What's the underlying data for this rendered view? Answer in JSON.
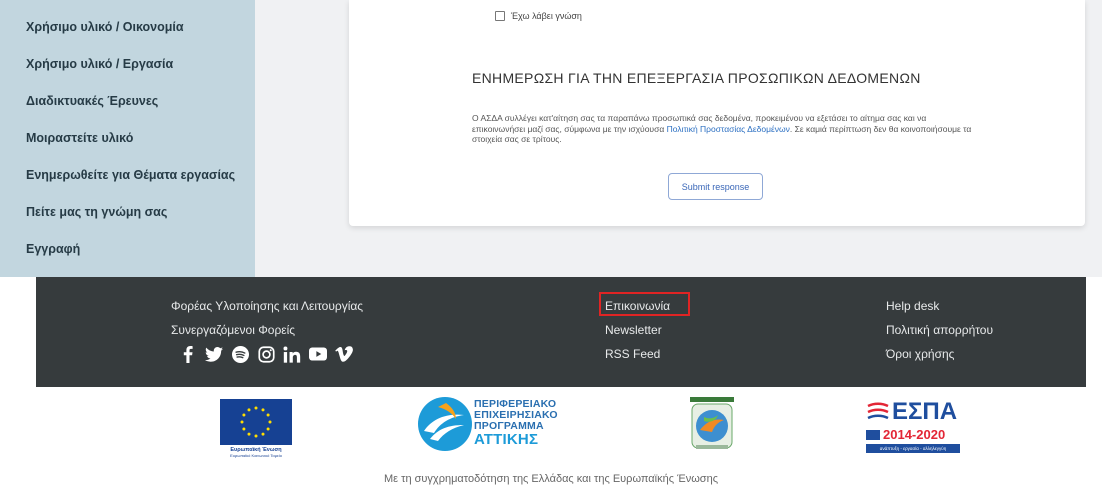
{
  "sidebar": {
    "items": [
      "Χρήσιμο υλικό / Οικονομία",
      "Χρήσιμο υλικό / Εργασία",
      "Διαδικτυακές Έρευνες",
      "Μοιραστείτε υλικό",
      "Ενημερωθείτε για Θέματα εργασίας",
      "Πείτε μας τη γνώμη σας",
      "Εγγραφή"
    ]
  },
  "form": {
    "checkbox_label": "Έχω λάβει γνώση",
    "gdpr_title": "ΕΝΗΜΕΡΩΣΗ ΓΙΑ ΤΗΝ ΕΠΕΞΕΡΓΑΣΙΑ ΠΡΟΣΩΠΙΚΩΝ ΔΕΔΟΜΕΝΩΝ",
    "gdpr_text_before": "Ο ΑΣΔΑ συλλέγει κατ'αίτηση σας τα παραπάνω προσωπικά σας δεδομένα, προκειμένου να εξετάσει το αίτημα σας και να επικοινωνήσει μαζί σας, σύμφωνα με την ισχύουσα ",
    "gdpr_link": "Πολιτική Προστασίας Δεδομένων",
    "gdpr_text_after": ". Σε καμιά περίπτωση δεν θα κοινοποιήσουμε τα στοιχεία σας σε τρίτους.",
    "submit_label": "Submit response"
  },
  "footer": {
    "col1": [
      "Φορέας Υλοποίησης και Λειτουργίας",
      "Συνεργαζόμενοι Φορείς"
    ],
    "col2": [
      "Επικοινωνία",
      "Newsletter",
      "RSS Feed"
    ],
    "col3": [
      "Help desk",
      "Πολιτική απορρήτου",
      "Όροι χρήσης"
    ],
    "social_icons": [
      "facebook-icon",
      "twitter-icon",
      "spotify-icon",
      "instagram-icon",
      "linkedin-icon",
      "youtube-icon",
      "vimeo-icon"
    ],
    "highlight_color": "#e02424"
  },
  "logos": {
    "eu_caption": "Ευρωπαϊκή Ένωση",
    "eu_subcaption": "Ευρωπαϊκό Κοινωνικό Ταμείο",
    "pep_lines": [
      "ΠΕΡΙΦΕΡΕΙΑΚΟ",
      "ΕΠΙΧΕΙΡΗΣΙΑΚΟ",
      "ΠΡΟΓΡΑΜΜΑ"
    ],
    "pep_region": "ΑΤΤΙΚΗΣ",
    "espa_title": "ΕΣΠΑ",
    "espa_years": "2014-2020",
    "espa_tagline": "ανάπτυξη - εργασία - αλληλεγγύη",
    "cofunding": "Με τη συγχρηματοδότηση της Ελλάδας και της Ευρωπαϊκής Ένωσης"
  },
  "colors": {
    "sidebar_bg": "#c2d6df",
    "footer_bg": "#363b3d",
    "link": "#2b6fc2"
  }
}
